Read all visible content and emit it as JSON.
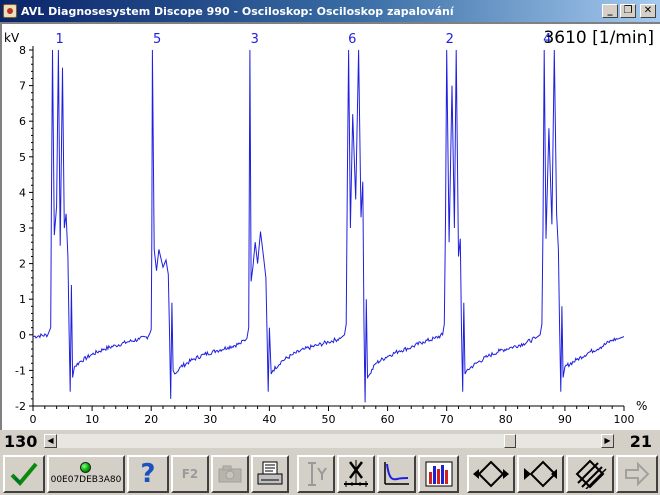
{
  "window": {
    "title": "AVL Diagnosesystem Discope 990 - Osciloskop: Osciloskop zapalování",
    "buttons": [
      "minimize",
      "restore",
      "close"
    ]
  },
  "scope": {
    "rpm_readout": "3610 [1/min]",
    "y_unit": "kV",
    "x_unit": "%",
    "trace_color": "#1f1fe0",
    "background": "#ffffff"
  },
  "chart_data": {
    "type": "line",
    "title": "",
    "xlabel": "%",
    "ylabel": "kV",
    "xlim": [
      0,
      100
    ],
    "ylim": [
      -2,
      8
    ],
    "x_ticks": [
      0,
      10,
      20,
      30,
      40,
      50,
      60,
      70,
      80,
      90,
      100
    ],
    "y_ticks": [
      -2,
      -1,
      0,
      1,
      2,
      3,
      4,
      5,
      6,
      7,
      8
    ],
    "cylinder_markers": [
      {
        "label": "1",
        "x": 3.5
      },
      {
        "label": "5",
        "x": 20.0
      },
      {
        "label": "3",
        "x": 36.5
      },
      {
        "label": "6",
        "x": 53.0
      },
      {
        "label": "2",
        "x": 69.5
      },
      {
        "label": "4",
        "x": 86.0
      }
    ],
    "series": [
      {
        "points": [
          [
            0,
            -0.05
          ],
          [
            2.5,
            0.0
          ],
          [
            3.0,
            0.2
          ],
          [
            3.1,
            3.2
          ],
          [
            3.3,
            8.0
          ],
          [
            3.6,
            2.8
          ],
          [
            4.0,
            3.6
          ],
          [
            4.3,
            8.0
          ],
          [
            4.6,
            2.5
          ],
          [
            5.0,
            7.5
          ],
          [
            5.3,
            3.0
          ],
          [
            5.6,
            3.4
          ],
          [
            5.9,
            2.2
          ],
          [
            6.1,
            0.1
          ],
          [
            6.3,
            -1.6
          ],
          [
            6.5,
            1.4
          ],
          [
            6.7,
            -1.2
          ],
          [
            7.0,
            -0.9
          ],
          [
            8.0,
            -0.75
          ],
          [
            10.0,
            -0.55
          ],
          [
            12.0,
            -0.4
          ],
          [
            14.0,
            -0.3
          ],
          [
            16.0,
            -0.2
          ],
          [
            18.0,
            -0.12
          ],
          [
            19.5,
            -0.05
          ],
          [
            19.8,
            0.05
          ],
          [
            20.0,
            0.15
          ],
          [
            20.1,
            2.6
          ],
          [
            20.2,
            8.0
          ],
          [
            20.5,
            2.4
          ],
          [
            20.9,
            1.8
          ],
          [
            21.3,
            2.4
          ],
          [
            22.0,
            1.9
          ],
          [
            22.5,
            2.1
          ],
          [
            22.9,
            1.7
          ],
          [
            23.1,
            0.1
          ],
          [
            23.3,
            -1.8
          ],
          [
            23.5,
            0.9
          ],
          [
            23.7,
            -1.0
          ],
          [
            24.0,
            -1.1
          ],
          [
            25.0,
            -0.9
          ],
          [
            27.0,
            -0.7
          ],
          [
            29.0,
            -0.55
          ],
          [
            31.0,
            -0.45
          ],
          [
            33.0,
            -0.35
          ],
          [
            35.0,
            -0.25
          ],
          [
            36.2,
            -0.1
          ],
          [
            36.5,
            0.2
          ],
          [
            36.7,
            8.0
          ],
          [
            36.9,
            1.5
          ],
          [
            37.2,
            1.9
          ],
          [
            37.6,
            2.6
          ],
          [
            38.0,
            2.0
          ],
          [
            38.5,
            2.9
          ],
          [
            39.0,
            2.2
          ],
          [
            39.4,
            1.6
          ],
          [
            39.6,
            0.1
          ],
          [
            39.8,
            -1.6
          ],
          [
            40.0,
            0.2
          ],
          [
            40.3,
            -1.1
          ],
          [
            40.6,
            -1.0
          ],
          [
            42.0,
            -0.75
          ],
          [
            44.0,
            -0.55
          ],
          [
            46.0,
            -0.4
          ],
          [
            48.0,
            -0.3
          ],
          [
            50.0,
            -0.2
          ],
          [
            52.0,
            -0.1
          ],
          [
            52.7,
            0.0
          ],
          [
            53.0,
            0.3
          ],
          [
            53.2,
            4.5
          ],
          [
            53.4,
            8.0
          ],
          [
            53.7,
            3.0
          ],
          [
            54.1,
            6.2
          ],
          [
            54.6,
            3.8
          ],
          [
            55.1,
            8.0
          ],
          [
            55.5,
            3.3
          ],
          [
            55.8,
            4.3
          ],
          [
            56.0,
            0.2
          ],
          [
            56.2,
            -1.9
          ],
          [
            56.4,
            1.0
          ],
          [
            56.6,
            -1.2
          ],
          [
            57.0,
            -1.1
          ],
          [
            58.0,
            -0.8
          ],
          [
            60.0,
            -0.6
          ],
          [
            62.0,
            -0.45
          ],
          [
            64.0,
            -0.35
          ],
          [
            66.0,
            -0.2
          ],
          [
            68.0,
            -0.1
          ],
          [
            69.3,
            0.0
          ],
          [
            69.6,
            0.3
          ],
          [
            69.8,
            3.2
          ],
          [
            70.0,
            8.0
          ],
          [
            70.4,
            2.6
          ],
          [
            70.9,
            7.0
          ],
          [
            71.3,
            3.0
          ],
          [
            71.6,
            8.0
          ],
          [
            72.0,
            2.2
          ],
          [
            72.3,
            2.7
          ],
          [
            72.5,
            0.1
          ],
          [
            72.7,
            -1.6
          ],
          [
            72.9,
            0.9
          ],
          [
            73.1,
            -1.1
          ],
          [
            73.4,
            -1.0
          ],
          [
            75.0,
            -0.8
          ],
          [
            77.0,
            -0.6
          ],
          [
            79.0,
            -0.45
          ],
          [
            81.0,
            -0.35
          ],
          [
            83.0,
            -0.25
          ],
          [
            85.0,
            -0.1
          ],
          [
            85.8,
            0.0
          ],
          [
            86.1,
            0.3
          ],
          [
            86.3,
            3.0
          ],
          [
            86.5,
            8.0
          ],
          [
            86.8,
            2.7
          ],
          [
            87.3,
            5.8
          ],
          [
            87.8,
            3.1
          ],
          [
            88.2,
            8.0
          ],
          [
            88.6,
            3.4
          ],
          [
            88.9,
            2.4
          ],
          [
            89.1,
            0.2
          ],
          [
            89.3,
            -1.6
          ],
          [
            89.5,
            0.8
          ],
          [
            89.7,
            -1.2
          ],
          [
            90.0,
            -0.9
          ],
          [
            92.0,
            -0.7
          ],
          [
            94.0,
            -0.5
          ],
          [
            96.0,
            -0.35
          ],
          [
            98.0,
            -0.15
          ],
          [
            99.2,
            -0.1
          ],
          [
            100.0,
            -0.05
          ]
        ]
      }
    ]
  },
  "scroll": {
    "left_value": "130",
    "right_value": "21",
    "thumb_position": 0.84
  },
  "toolbar": {
    "connection_id": "00E07DEB3A80",
    "f2_label": "F2",
    "items": [
      "check-icon",
      "connection-led-icon",
      "help-icon",
      "f2-button",
      "camera-icon",
      "print-icon",
      "cursor-y-icon",
      "cursor-x-icon",
      "curve-icon",
      "bar-chart-icon",
      "zoom-diamond-icon",
      "shift-diamond-icon",
      "hatch-diamond-icon",
      "exit-arrow-icon"
    ]
  }
}
